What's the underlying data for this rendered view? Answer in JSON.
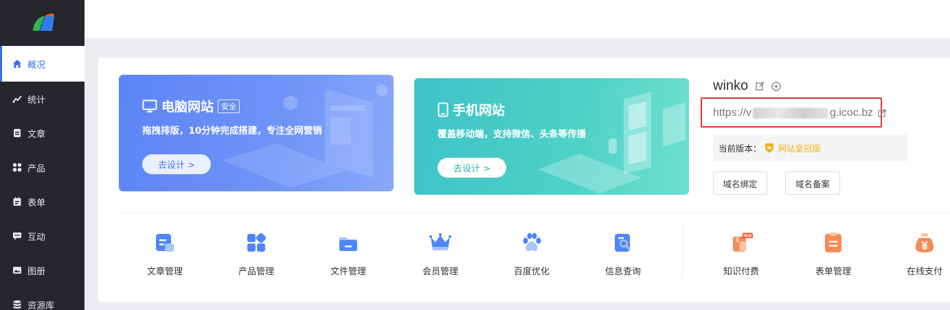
{
  "sidebar": {
    "items": [
      {
        "label": "概况",
        "icon": "home-icon"
      },
      {
        "label": "统计",
        "icon": "stats-icon"
      },
      {
        "label": "文章",
        "icon": "article-icon"
      },
      {
        "label": "产品",
        "icon": "product-icon"
      },
      {
        "label": "表单",
        "icon": "form-icon"
      },
      {
        "label": "互动",
        "icon": "chat-icon"
      },
      {
        "label": "图册",
        "icon": "gallery-icon"
      },
      {
        "label": "资源库",
        "icon": "database-icon"
      }
    ]
  },
  "pc_card": {
    "title": "电脑网站",
    "badge": "安全",
    "desc": "拖拽排版，10分钟完成搭建，专注全网营销",
    "button": "去设计 >"
  },
  "mobile_card": {
    "title": "手机网站",
    "desc": "覆盖移动端，支持微信、头条等传播",
    "button": "去设计 >"
  },
  "site": {
    "name": "winko",
    "url_prefix": "https://v",
    "url_suffix": "g.icoc.bz",
    "version_label": "当前版本：",
    "version_name": "网站皇冠版",
    "btn_domain_bind": "域名绑定",
    "btn_domain_record": "域名备案"
  },
  "tools": [
    {
      "label": "文章管理",
      "icon": "article-manage-icon"
    },
    {
      "label": "产品管理",
      "icon": "product-manage-icon"
    },
    {
      "label": "文件管理",
      "icon": "file-manage-icon"
    },
    {
      "label": "会员管理",
      "icon": "member-manage-icon"
    },
    {
      "label": "百度优化",
      "icon": "baidu-seo-icon"
    },
    {
      "label": "信息查询",
      "icon": "info-query-icon"
    },
    {
      "label": "知识付费",
      "icon": "paid-knowledge-icon",
      "badge": "NEW"
    },
    {
      "label": "表单管理",
      "icon": "form-manage-icon"
    },
    {
      "label": "在线支付",
      "icon": "online-pay-icon"
    }
  ],
  "colors": {
    "accent": "#3a6df0",
    "sidebar_bg": "#25272b",
    "highlight_border": "#e53232",
    "crown": "#f2b21c"
  }
}
